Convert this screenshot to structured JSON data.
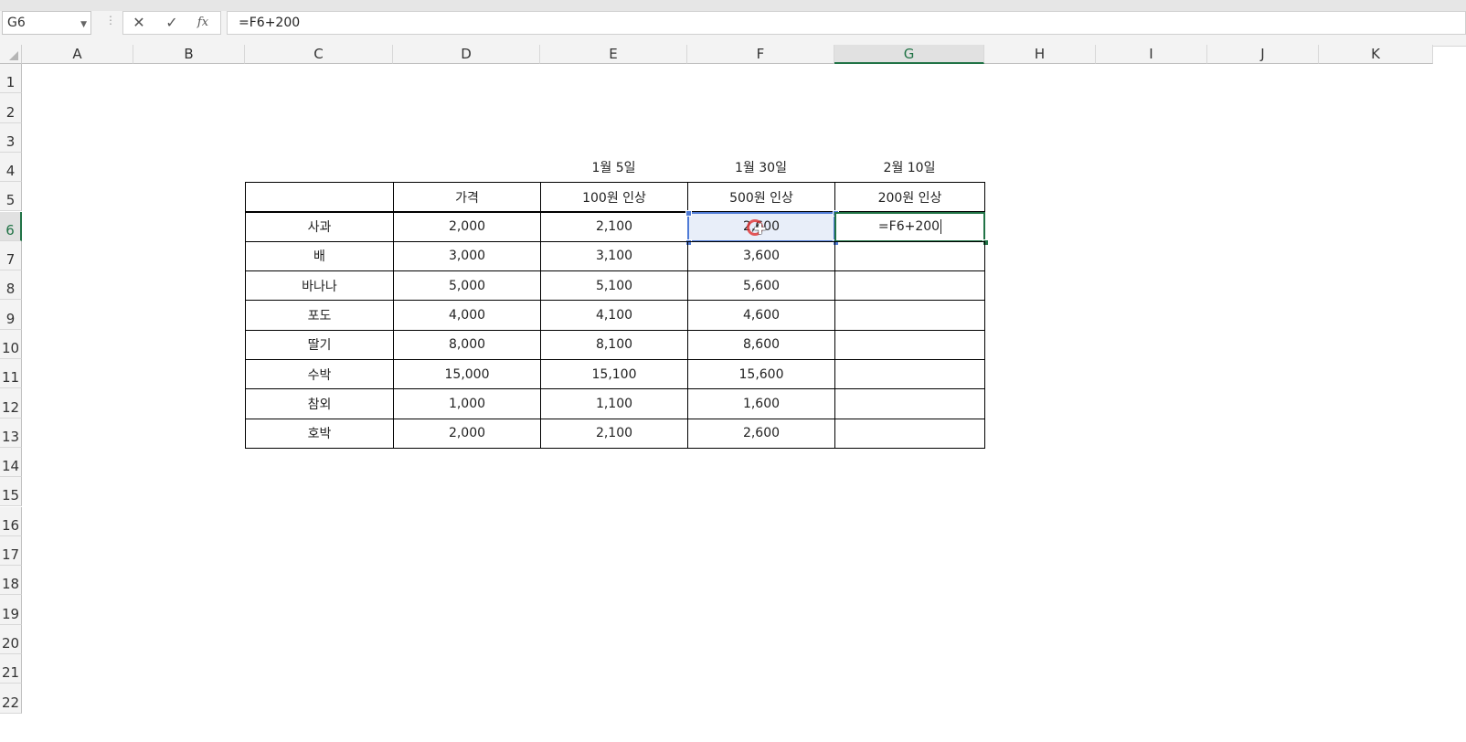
{
  "formula_bar": {
    "name_box": "G6",
    "separator": "⋮",
    "cancel_icon": "✕",
    "enter_icon": "✓",
    "fx_label": "fx",
    "formula": "=F6+200"
  },
  "columns": [
    "A",
    "B",
    "C",
    "D",
    "E",
    "F",
    "G",
    "H",
    "I",
    "J",
    "K"
  ],
  "rows": [
    "1",
    "2",
    "3",
    "4",
    "5",
    "6",
    "7",
    "8",
    "9",
    "10",
    "11",
    "12",
    "13",
    "14",
    "15",
    "16",
    "17",
    "18",
    "19",
    "20",
    "21",
    "22"
  ],
  "selected_column": "G",
  "selected_row": "6",
  "sheet": {
    "dates": [
      "1월 5일",
      "1월 30일",
      "2월 10일"
    ],
    "headers": [
      "",
      "가격",
      "100원 인상",
      "500원 인상",
      "200원 인상"
    ],
    "rows": [
      [
        "사과",
        "2,000",
        "2,100",
        "2,600",
        "=F6+200"
      ],
      [
        "배",
        "3,000",
        "3,100",
        "3,600",
        ""
      ],
      [
        "바나나",
        "5,000",
        "5,100",
        "5,600",
        ""
      ],
      [
        "포도",
        "4,000",
        "4,100",
        "4,600",
        ""
      ],
      [
        "딸기",
        "8,000",
        "8,100",
        "8,600",
        ""
      ],
      [
        "수박",
        "15,000",
        "15,100",
        "15,600",
        ""
      ],
      [
        "참외",
        "1,000",
        "1,100",
        "1,600",
        ""
      ],
      [
        "호박",
        "2,000",
        "2,100",
        "2,600",
        ""
      ]
    ]
  },
  "colors": {
    "selection_green": "#217346",
    "reference_blue": "#4f7bd6"
  }
}
